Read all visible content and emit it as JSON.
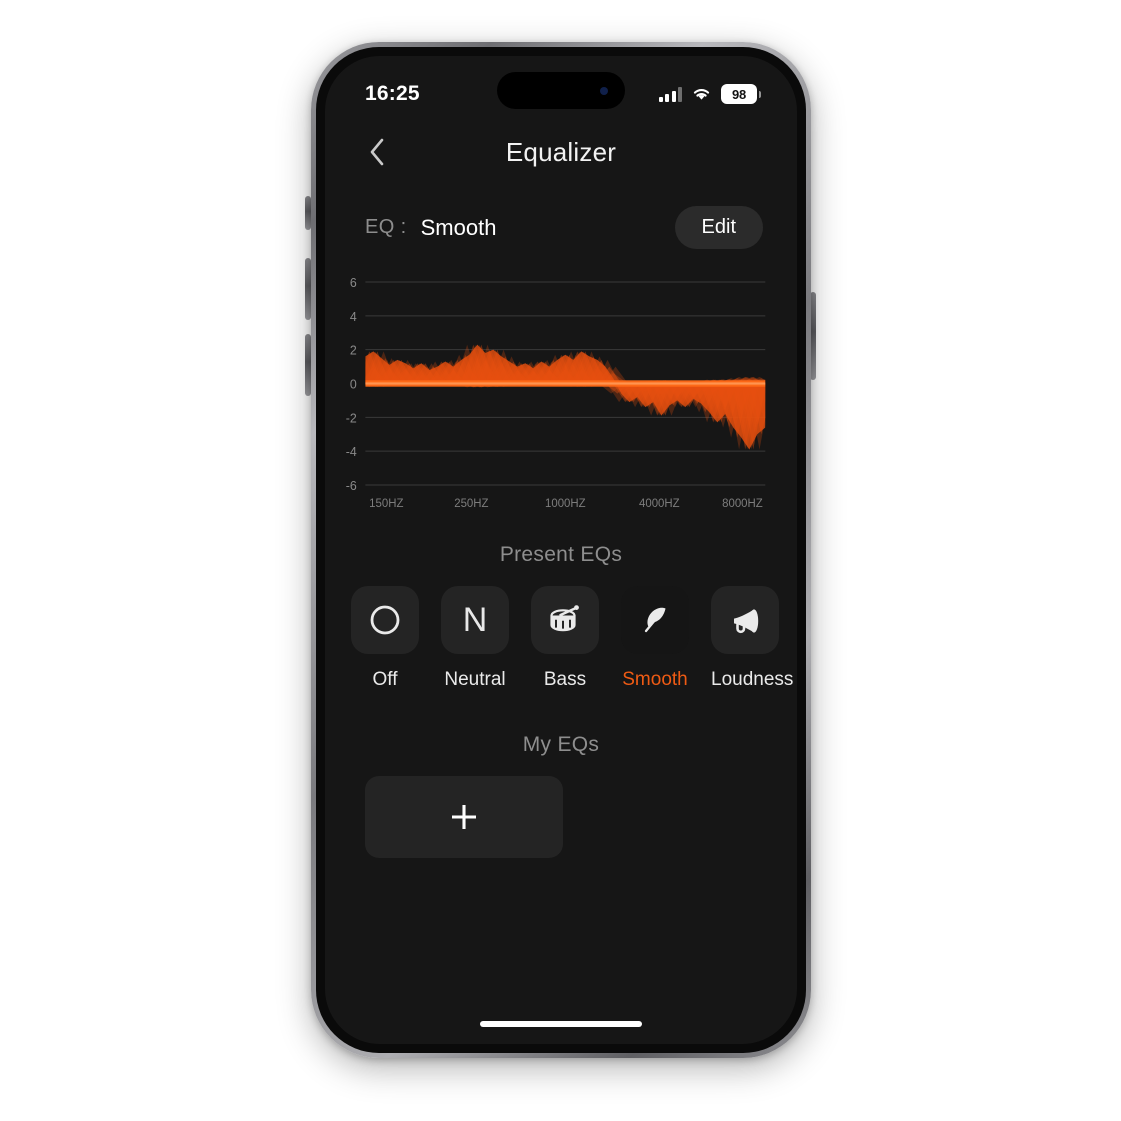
{
  "status_bar": {
    "time": "16:25",
    "battery_level": "98",
    "signal_icon": "cellular-bars-icon",
    "wifi_icon": "wifi-icon",
    "battery_icon": "battery-icon"
  },
  "nav": {
    "back_icon": "chevron-left-icon",
    "title": "Equalizer"
  },
  "eq_header": {
    "label": "EQ :",
    "value": "Smooth",
    "edit_label": "Edit"
  },
  "sections": {
    "present_eqs_title": "Present EQs",
    "my_eqs_title": "My EQs"
  },
  "presets": [
    {
      "label": "Off",
      "icon": "circle-icon",
      "selected": false
    },
    {
      "label": "Neutral",
      "icon": "letter-n-icon",
      "selected": false
    },
    {
      "label": "Bass",
      "icon": "drum-icon",
      "selected": false
    },
    {
      "label": "Smooth",
      "icon": "feather-icon",
      "selected": true
    },
    {
      "label": "Loudness",
      "icon": "megaphone-icon",
      "selected": false
    }
  ],
  "my_eqs": {
    "add_icon": "plus-icon"
  },
  "colors": {
    "accent": "#ef5b14",
    "curve_fill": "#e8500f",
    "screen_bg": "#161616",
    "tile_bg": "#242424",
    "tile_bg_selected": "#151515",
    "muted_text": "#8e8e8e"
  },
  "chart_data": {
    "type": "area",
    "title": "",
    "xlabel": "",
    "ylabel": "",
    "ylim": [
      -6,
      6
    ],
    "yticks": [
      6,
      4,
      2,
      0,
      -2,
      -4,
      -6
    ],
    "xtick_labels": [
      "150HZ",
      "250HZ",
      "1000HZ",
      "4000HZ",
      "8000HZ"
    ],
    "xtick_positions": [
      0.035,
      0.265,
      0.5,
      0.735,
      0.965
    ],
    "grid": true,
    "legend": "none",
    "baseline": 0,
    "series": [
      {
        "name": "Smooth EQ response (dB)",
        "x": [
          0.0,
          0.02,
          0.04,
          0.06,
          0.08,
          0.1,
          0.12,
          0.14,
          0.16,
          0.18,
          0.2,
          0.22,
          0.24,
          0.26,
          0.28,
          0.3,
          0.32,
          0.34,
          0.36,
          0.38,
          0.4,
          0.42,
          0.44,
          0.46,
          0.48,
          0.5,
          0.52,
          0.54,
          0.56,
          0.58,
          0.6,
          0.62,
          0.64,
          0.66,
          0.68,
          0.7,
          0.72,
          0.74,
          0.76,
          0.78,
          0.8,
          0.82,
          0.84,
          0.86,
          0.88,
          0.9,
          0.92,
          0.94,
          0.96,
          0.98,
          1.0
        ],
        "values": [
          1.6,
          1.9,
          1.5,
          1.1,
          1.4,
          1.2,
          0.9,
          1.2,
          0.8,
          1.0,
          1.3,
          1.0,
          1.4,
          1.7,
          2.3,
          1.8,
          2.0,
          1.6,
          1.3,
          1.0,
          1.2,
          0.9,
          1.3,
          1.0,
          1.4,
          1.7,
          1.4,
          1.9,
          1.6,
          1.4,
          1.0,
          0.3,
          -0.6,
          -1.1,
          -0.8,
          -1.4,
          -1.1,
          -1.9,
          -1.3,
          -1.0,
          -1.4,
          -0.9,
          -1.2,
          -1.7,
          -2.3,
          -1.8,
          -2.6,
          -3.2,
          -3.9,
          -3.0,
          -2.6
        ]
      }
    ]
  }
}
